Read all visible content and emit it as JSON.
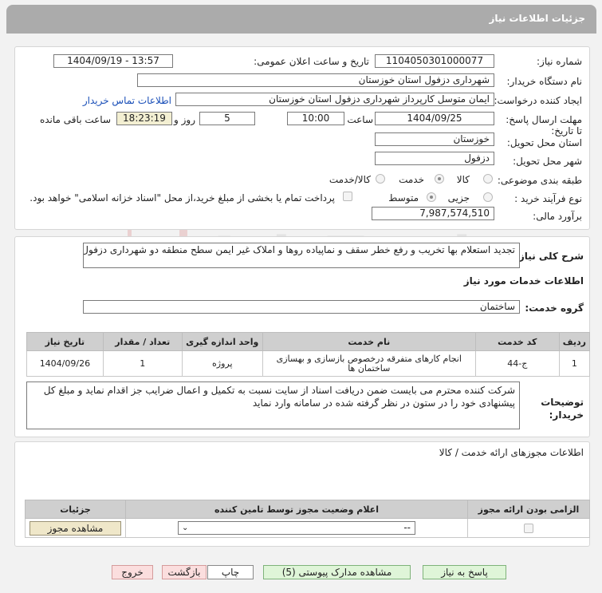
{
  "header": {
    "title": "جزئیات اطلاعات نیاز"
  },
  "details": {
    "need_number_label": "شماره نیاز:",
    "need_number": "1104050301000077",
    "announce_label": "تاریخ و ساعت اعلان عمومی:",
    "announce_value": "1404/09/19 - 13:57",
    "buyer_org_label": "نام دستگاه خریدار:",
    "buyer_org": "شهرداری دزفول استان خوزستان",
    "creator_label": "ایجاد کننده درخواست:",
    "creator": "ایمان متوسل کارپرداز شهرداری دزفول استان خوزستان",
    "contact_link": "اطلاعات تماس خریدار",
    "deadline_label": "مهلت ارسال پاسخ: تا تاریخ:",
    "deadline_date": "1404/09/25",
    "time_label": "ساعت",
    "deadline_time": "10:00",
    "days_value": "5",
    "days_label": "روز و",
    "remaining_time": "18:23:19",
    "remaining_label": "ساعت باقی مانده",
    "province_label": "استان محل تحویل:",
    "province": "خوزستان",
    "city_label": "شهر محل تحویل:",
    "city": "دزفول",
    "category_label": "طبقه بندی موضوعی:",
    "category_options": [
      "کالا",
      "خدمت",
      "کالا/خدمت"
    ],
    "process_label": "نوع فرآیند خرید :",
    "process_options": [
      "جزیی",
      "متوسط"
    ],
    "treasury_note": "پرداخت تمام یا بخشی از مبلغ خرید،از محل \"اسناد خزانه اسلامی\" خواهد بود.",
    "budget_label": "برآورد مالی:",
    "budget": "7,987,574,510"
  },
  "summary": {
    "label": "شرح کلی نیاز:",
    "text": "تجدید استعلام بها تخریب و رفع خطر سقف و نماپیاده روها و املاک غیر ایمن سطح منطقه دو شهرداری دزفول"
  },
  "services": {
    "section_title": "اطلاعات خدمات مورد نیاز",
    "group_label": "گروه خدمت:",
    "group_value": "ساختمان",
    "columns": [
      "ردیف",
      "کد خدمت",
      "نام خدمت",
      "واحد اندازه گیری",
      "تعداد / مقدار",
      "تاریخ نیاز"
    ],
    "rows": [
      {
        "row": "1",
        "code": "ج-44",
        "name": "انجام کارهای متفرقه درخصوص بازسازی و بهسازی ساختمان ها",
        "unit": "پروژه",
        "qty": "1",
        "date": "1404/09/26"
      }
    ],
    "buyer_notes_label": "توضیحات خریدار:",
    "buyer_notes": "شرکت کننده محترم می بایست ضمن دریافت اسناد از سایت نسبت به تکمیل و اعمال ضرایب جز اقدام نماید و مبلغ کل پیشنهادی خود را در ستون در نظر گرفته شده در سامانه وارد نماید"
  },
  "permits": {
    "section_title": "اطلاعات مجوزهای ارائه خدمت / کالا",
    "columns": [
      "الزامی بودن ارائه مجوز",
      "اعلام وضعیت مجوز توسط تامین کننده",
      "جزئیات"
    ],
    "select_value": "--",
    "view_button": "مشاهده مجوز"
  },
  "footer": {
    "reply": "پاسخ به نیاز",
    "docs": "مشاهده مدارک پیوستی (5)",
    "print": "چاپ",
    "back": "بازگشت",
    "exit": "خروج"
  },
  "watermark": "AriaTender.neT"
}
